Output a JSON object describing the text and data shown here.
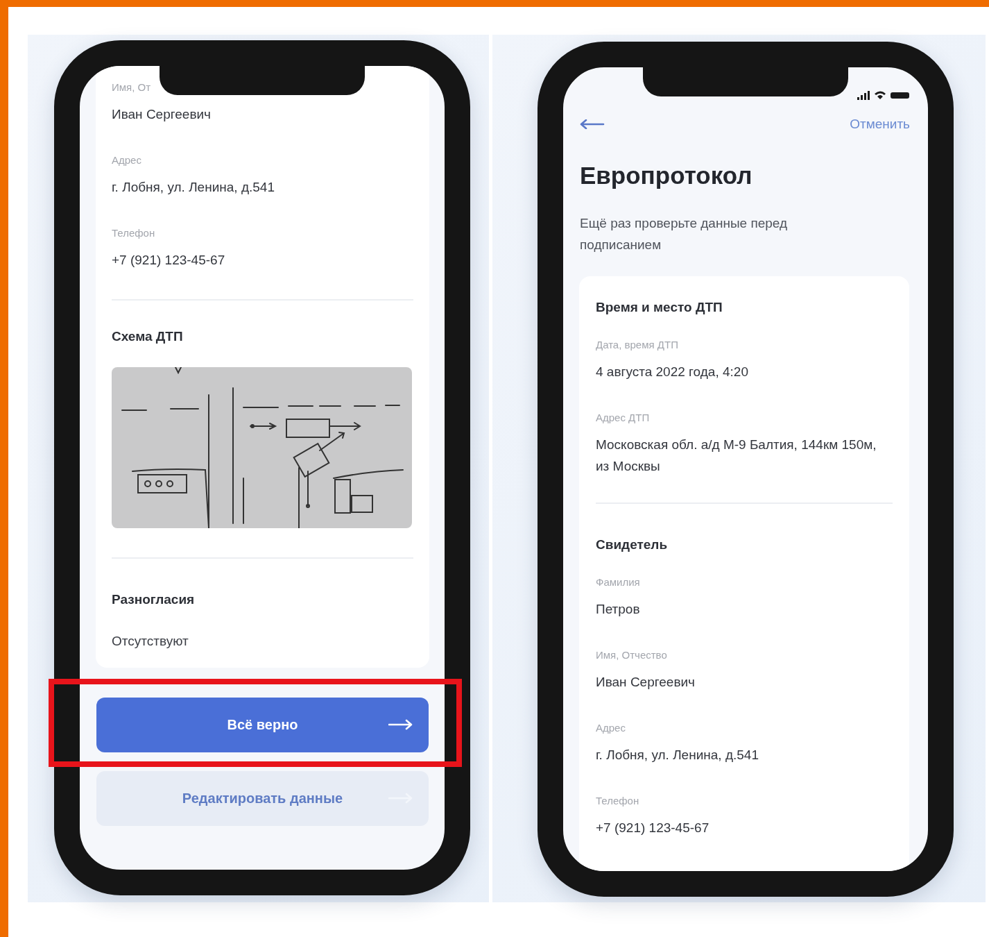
{
  "left_screen": {
    "fields": [
      {
        "label": "Имя, От",
        "value": "Иван Сергеевич"
      },
      {
        "label": "Адрес",
        "value": "г. Лобня, ул. Ленина, д.541"
      },
      {
        "label": "Телефон",
        "value": "+7 (921) 123-45-67"
      }
    ],
    "scheme": {
      "title": "Схема ДТП"
    },
    "disagreements": {
      "title": "Разногласия",
      "value": "Отсутствуют"
    },
    "buttons": [
      {
        "label": "Всё верно",
        "kind": "primary",
        "highlighted": true
      },
      {
        "label": "Редактировать данные",
        "kind": "secondary",
        "highlighted": false
      }
    ]
  },
  "right_screen": {
    "cancel_link": "Отменить",
    "title": "Европротокол",
    "subtitle": "Ещё раз проверьте данные перед подписанием",
    "sections": [
      {
        "title": "Время и место ДТП",
        "fields": [
          {
            "label": "Дата, время ДТП",
            "value": "4 августа 2022 года, 4:20"
          },
          {
            "label": "Адрес ДТП",
            "value": "Московская обл. а/д  М-9 Балтия, 144км 150м, из Москвы"
          }
        ]
      },
      {
        "title": "Свидетель",
        "fields": [
          {
            "label": "Фамилия",
            "value": "Петров"
          },
          {
            "label": "Имя, Отчество",
            "value": "Иван Сергеевич"
          },
          {
            "label": "Адрес",
            "value": "г. Лобня, ул. Ленина, д.541"
          },
          {
            "label": "Телефон",
            "value": "+7 (921) 123-45-67"
          }
        ]
      }
    ]
  }
}
